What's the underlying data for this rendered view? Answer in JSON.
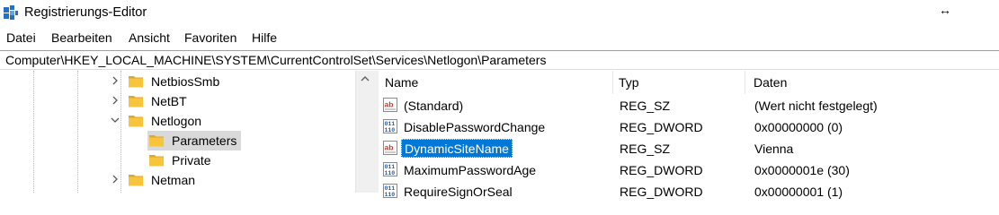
{
  "window": {
    "title": "Registrierungs-Editor",
    "resize_glyph": "↔",
    "icon": "regedit-icon"
  },
  "menu": [
    "Datei",
    "Bearbeiten",
    "Ansicht",
    "Favoriten",
    "Hilfe"
  ],
  "address": "Computer\\HKEY_LOCAL_MACHINE\\SYSTEM\\CurrentControlSet\\Services\\Netlogon\\Parameters",
  "tree": {
    "items": [
      {
        "label": "NetbiosSmb",
        "state": "collapsed"
      },
      {
        "label": "NetBT",
        "state": "collapsed"
      },
      {
        "label": "Netlogon",
        "state": "expanded"
      },
      {
        "label": "Parameters",
        "state": "leaf",
        "selected": true
      },
      {
        "label": "Private",
        "state": "leaf"
      },
      {
        "label": "Netman",
        "state": "collapsed"
      }
    ]
  },
  "list": {
    "columns": [
      "Name",
      "Typ",
      "Daten"
    ],
    "rows": [
      {
        "name": "(Standard)",
        "type": "REG_SZ",
        "data": "(Wert nicht festgelegt)",
        "icon": "string-value-icon"
      },
      {
        "name": "DisablePasswordChange",
        "type": "REG_DWORD",
        "data": "0x00000000 (0)",
        "icon": "binary-value-icon"
      },
      {
        "name": "DynamicSiteName",
        "type": "REG_SZ",
        "data": "Vienna",
        "icon": "string-value-icon",
        "selected": true
      },
      {
        "name": "MaximumPasswordAge",
        "type": "REG_DWORD",
        "data": "0x0000001e (30)",
        "icon": "binary-value-icon"
      },
      {
        "name": "RequireSignOrSeal",
        "type": "REG_DWORD",
        "data": "0x00000001 (1)",
        "icon": "binary-value-icon"
      }
    ]
  },
  "colors": {
    "selection": "#0078d7",
    "tree_selection": "#d9d9d9",
    "folder": "#f8c43b"
  }
}
